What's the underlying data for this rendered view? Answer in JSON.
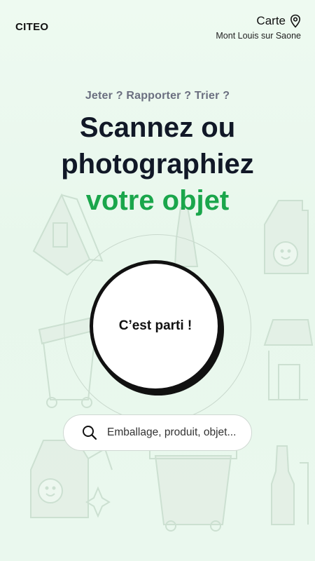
{
  "header": {
    "brand": "CITEO",
    "map_label": "Carte",
    "location": "Mont Louis sur Saone"
  },
  "hero": {
    "kicker": "Jeter ? Rapporter ? Trier ?",
    "line1": "Scannez ou",
    "line2": "photographiez",
    "line3": "votre objet"
  },
  "cta": {
    "label": "C’est parti !"
  },
  "search": {
    "placeholder": "Emballage, produit, objet..."
  },
  "colors": {
    "accent": "#1aa64b",
    "text": "#111827",
    "background": "#eaf8ee"
  },
  "icons": [
    "map-pin-icon",
    "search-icon"
  ]
}
